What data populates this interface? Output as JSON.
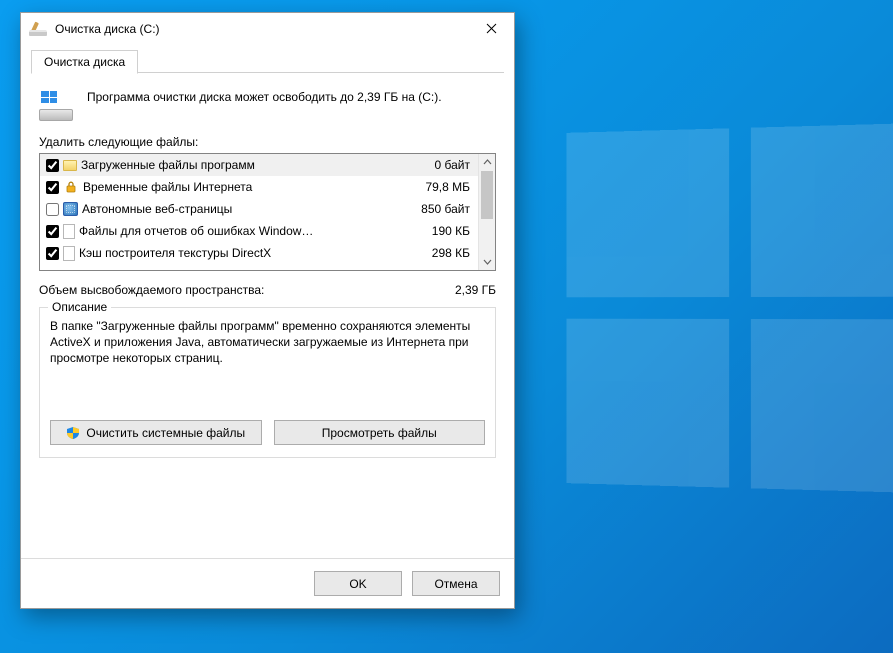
{
  "window": {
    "title": "Очистка диска  (C:)"
  },
  "tab": {
    "label": "Очистка диска"
  },
  "info_text": "Программа очистки диска может освободить до 2,39 ГБ на (C:).",
  "list_label": "Удалить следующие файлы:",
  "items": [
    {
      "checked": true,
      "icon": "folder",
      "name": "Загруженные файлы программ",
      "size": "0 байт",
      "selected": true
    },
    {
      "checked": true,
      "icon": "lock",
      "name": "Временные файлы Интернета",
      "size": "79,8 МБ",
      "selected": false
    },
    {
      "checked": false,
      "icon": "globe",
      "name": "Автономные веб-страницы",
      "size": "850 байт",
      "selected": false
    },
    {
      "checked": true,
      "icon": "page",
      "name": "Файлы для отчетов об ошибках Window…",
      "size": "190 КБ",
      "selected": false
    },
    {
      "checked": true,
      "icon": "page",
      "name": "Кэш построителя текстуры DirectX",
      "size": "298 КБ",
      "selected": false
    }
  ],
  "total": {
    "label": "Объем высвобождаемого пространства:",
    "value": "2,39 ГБ"
  },
  "group": {
    "legend": "Описание",
    "text": "В папке \"Загруженные файлы программ\" временно сохраняются элементы ActiveX и приложения Java, автоматически загружаемые из Интернета при просмотре некоторых страниц."
  },
  "buttons": {
    "clean_system": "Очистить системные файлы",
    "view_files": "Просмотреть файлы",
    "ok": "OK",
    "cancel": "Отмена"
  }
}
